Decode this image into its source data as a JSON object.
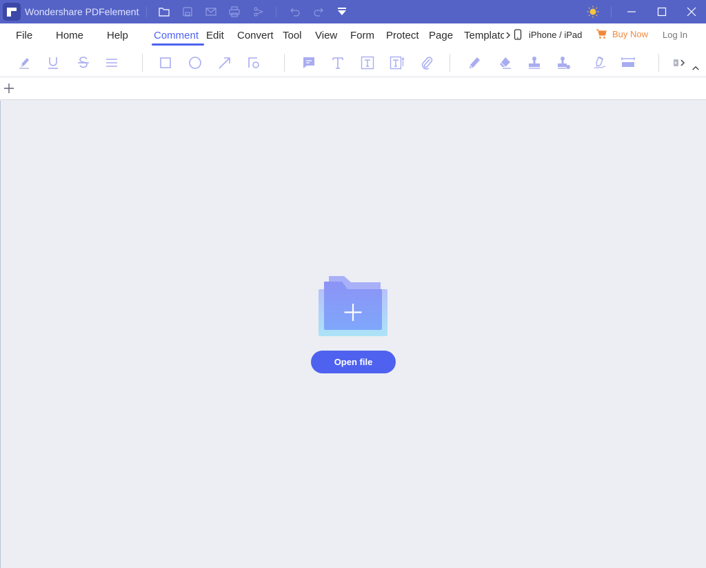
{
  "window": {
    "title": "Wondershare PDFelement",
    "quick_actions": [
      "open-folder",
      "save",
      "email",
      "print",
      "share",
      "undo",
      "redo",
      "customize-quick-access"
    ],
    "window_controls": [
      "theme-toggle",
      "minimize",
      "maximize",
      "close"
    ]
  },
  "menu": {
    "items": [
      {
        "label": "File",
        "active": false
      },
      {
        "label": "Home",
        "active": false
      },
      {
        "label": "Help",
        "active": false
      },
      {
        "label": "Comment",
        "active": true
      },
      {
        "label": "Edit",
        "active": false
      },
      {
        "label": "Convert",
        "active": false
      },
      {
        "label": "Tool",
        "active": false
      },
      {
        "label": "View",
        "active": false
      },
      {
        "label": "Form",
        "active": false
      },
      {
        "label": "Protect",
        "active": false
      },
      {
        "label": "Page",
        "active": false
      },
      {
        "label": "Templatс",
        "active": false
      }
    ],
    "device_label": "iPhone / iPad",
    "buy_now_label": "Buy Now",
    "login_label": "Log In"
  },
  "toolbar": {
    "tools": [
      {
        "name": "highlight",
        "has_dropdown": false
      },
      {
        "name": "underline",
        "has_dropdown": false
      },
      {
        "name": "strikethrough",
        "has_dropdown": false
      },
      {
        "name": "text-markup-more",
        "has_dropdown": true
      },
      {
        "name": "rectangle",
        "has_dropdown": false
      },
      {
        "name": "oval",
        "has_dropdown": false
      },
      {
        "name": "arrow",
        "has_dropdown": false
      },
      {
        "name": "shapes-more",
        "has_dropdown": true
      },
      {
        "name": "sticky-note",
        "has_dropdown": false
      },
      {
        "name": "typewriter",
        "has_dropdown": false
      },
      {
        "name": "text-box",
        "has_dropdown": false
      },
      {
        "name": "text-callout",
        "has_dropdown": false
      },
      {
        "name": "attachment",
        "has_dropdown": false
      },
      {
        "name": "pencil",
        "has_dropdown": false
      },
      {
        "name": "eraser",
        "has_dropdown": false
      },
      {
        "name": "stamp",
        "has_dropdown": false
      },
      {
        "name": "custom-stamp",
        "has_dropdown": true
      },
      {
        "name": "signature",
        "has_dropdown": false
      },
      {
        "name": "measure",
        "has_dropdown": true
      },
      {
        "name": "show-hide-comments",
        "has_dropdown": false
      }
    ]
  },
  "colors": {
    "titlebar": "#5563c6",
    "accent": "#4e62ef",
    "tool_icon": "#a8acf0",
    "buy_now": "#f28a3b",
    "workspace_bg": "#eceef3"
  },
  "workspace": {
    "open_file_label": "Open file"
  }
}
